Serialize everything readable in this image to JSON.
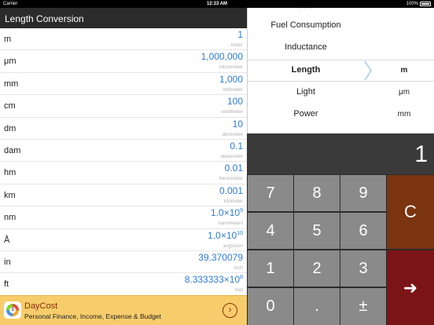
{
  "status": {
    "carrier": "Carrier",
    "time": "12:33 AM",
    "battery": "100%"
  },
  "nav": {
    "title": "Length Conversion"
  },
  "rows": [
    {
      "unit": "m",
      "value": "1",
      "exp": "",
      "name": "meter"
    },
    {
      "unit": "μm",
      "value": "1,000,000",
      "exp": "",
      "name": "micrometer"
    },
    {
      "unit": "mm",
      "value": "1,000",
      "exp": "",
      "name": "millimeter"
    },
    {
      "unit": "cm",
      "value": "100",
      "exp": "",
      "name": "centimeter"
    },
    {
      "unit": "dm",
      "value": "10",
      "exp": "",
      "name": "decimeter"
    },
    {
      "unit": "dam",
      "value": "0.1",
      "exp": "",
      "name": "dekameter"
    },
    {
      "unit": "hm",
      "value": "0.01",
      "exp": "",
      "name": "hectometer"
    },
    {
      "unit": "km",
      "value": "0.001",
      "exp": "",
      "name": "kilometer"
    },
    {
      "unit": "nm",
      "value": "1.0×10",
      "exp": "9",
      "name": "nanometers"
    },
    {
      "unit": "Å",
      "value": "1.0×10",
      "exp": "10",
      "name": "angstrom"
    },
    {
      "unit": "in",
      "value": "39.370079",
      "exp": "",
      "name": "inch"
    },
    {
      "unit": "ft",
      "value": "8.333333×10",
      "exp": "8",
      "name": "foot"
    }
  ],
  "ad": {
    "title": "DayCost",
    "subtitle": "Personal Finance, Income, Expense & Budget",
    "logo_text": "$",
    "icon": "chevron-right-circle-icon"
  },
  "picker": {
    "categories": [
      "Fuel Consumption",
      "Inductance",
      "Length",
      "Light",
      "Power"
    ],
    "selected_category": "Length",
    "units": [
      "m",
      "μm",
      "mm"
    ],
    "selected_unit": "m"
  },
  "display": {
    "value": "1"
  },
  "keys": {
    "k7": "7",
    "k8": "8",
    "k9": "9",
    "clear": "C",
    "k4": "4",
    "k5": "5",
    "k6": "6",
    "k1": "1",
    "k2": "2",
    "k3": "3",
    "enter": "➜",
    "k0": "0",
    "dot": ".",
    "sign": "±"
  },
  "colors": {
    "accent_blue": "#2f7ad6",
    "clear_key": "#7a3410",
    "enter_key": "#7b1416",
    "ad_bg": "#f7cd6c"
  }
}
